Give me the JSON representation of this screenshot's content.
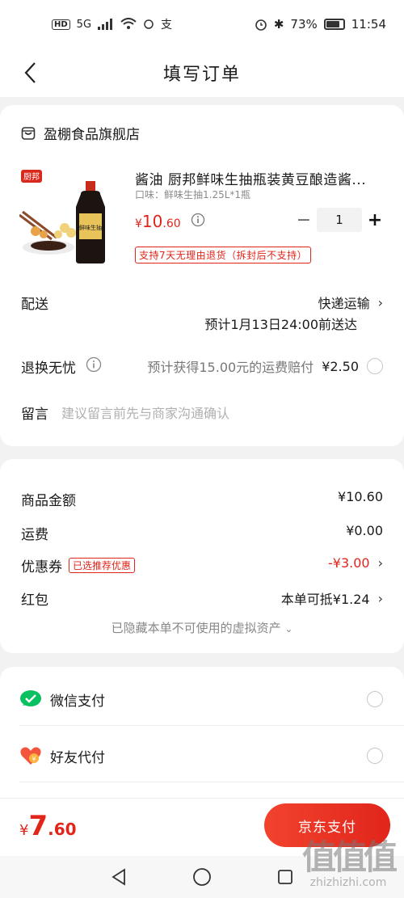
{
  "status_bar": {
    "hd": "HD",
    "network": "5G",
    "battery_percent": "73%",
    "battery_level": 0.73,
    "time": "11:54"
  },
  "nav": {
    "title": "填写订单"
  },
  "shop": {
    "name": "盈棚食品旗舰店"
  },
  "product": {
    "brand_logo": "厨邦",
    "bottle_label": "鲜味生抽",
    "title": "酱油 厨邦鲜味生抽瓶装黄豆酿造酱...",
    "spec": "口味：鲜味生抽1.25L*1瓶",
    "price_currency": "¥",
    "price_int": "10",
    "price_dec": ".60",
    "quantity": "1",
    "return_policy": "支持7天无理由退货（拆封后不支持）"
  },
  "delivery": {
    "label": "配送",
    "method": "快递运输",
    "eta": "预计1月13日24:00前送达"
  },
  "return_guarantee": {
    "label": "退换无忧",
    "text": "预计获得15.00元的运费赔付",
    "price": "¥2.50"
  },
  "note": {
    "label": "留言",
    "placeholder": "建议留言前先与商家沟通确认"
  },
  "summary": {
    "goods_label": "商品金额",
    "goods_value": "¥10.60",
    "shipping_label": "运费",
    "shipping_value": "¥0.00",
    "coupon_label": "优惠券",
    "coupon_tag": "已选推荐优惠",
    "coupon_value": "-¥3.00",
    "redpacket_label": "红包",
    "redpacket_value": "本单可抵¥1.24",
    "hidden_assets": "已隐藏本单不可使用的虚拟资产"
  },
  "payment": {
    "wechat_label": "微信支付",
    "friend_label": "好友代付"
  },
  "bottom": {
    "currency": "¥",
    "total_int": "7",
    "total_dec": ".60",
    "pay_button": "京东支付"
  },
  "watermark": {
    "mark": "值值值",
    "url": "zhizhizhi.com"
  },
  "colors": {
    "accent": "#e1251b",
    "wechat": "#07c160",
    "friend": "#f2543e"
  }
}
